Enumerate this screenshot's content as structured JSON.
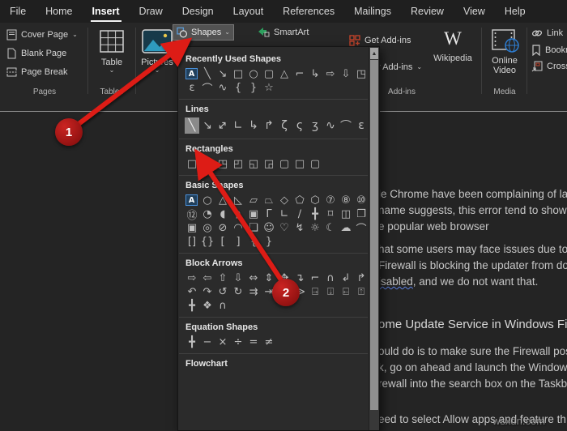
{
  "menu_tabs": [
    {
      "label": "File"
    },
    {
      "label": "Home"
    },
    {
      "label": "Insert",
      "active": true
    },
    {
      "label": "Draw"
    },
    {
      "label": "Design"
    },
    {
      "label": "Layout"
    },
    {
      "label": "References"
    },
    {
      "label": "Mailings"
    },
    {
      "label": "Review"
    },
    {
      "label": "View"
    },
    {
      "label": "Help"
    }
  ],
  "ribbon": {
    "pages_group": {
      "label": "Pages",
      "cover_page": "Cover Page",
      "blank_page": "Blank Page",
      "page_break": "Page Break"
    },
    "tables_group": {
      "label": "Tables",
      "table_button": "Table"
    },
    "pictures_button": "Pictures",
    "shapes_button": "Shapes",
    "smartart_button": "SmartArt",
    "addins_group": {
      "label": "Add-ins",
      "get_addins": "Get Add-ins",
      "my_addins": "My Add-ins",
      "wikipedia": "Wikipedia"
    },
    "media_group": {
      "label": "Media",
      "online": "Online",
      "video": "Video"
    },
    "links_group": {
      "link": "Link",
      "bookmark": "Bookmark",
      "cross_reference": "Cross-reference"
    }
  },
  "shapes_menu": {
    "sections": [
      {
        "title": "Recently Used Shapes",
        "rows": [
          [
            {
              "g": "A",
              "cls": "textbox"
            },
            "╲",
            "↘",
            "□",
            "○",
            "▢",
            "△",
            "⌐",
            "↳",
            "⇨",
            "⇩",
            "◳"
          ],
          [
            "ε",
            "⌒",
            "∿",
            "{",
            "}",
            "☆"
          ]
        ]
      },
      {
        "title": "Lines",
        "rows": [
          [
            {
              "g": "╲",
              "cls": "hl"
            },
            "↘",
            {
              "g": "↔",
              "rot": -45
            },
            "∟",
            "↳",
            "↱",
            "ζ",
            "ς",
            "ʒ",
            "∿",
            "⌒",
            "ε"
          ]
        ]
      },
      {
        "title": "Rectangles",
        "rows": [
          [
            "□",
            "▢",
            "◳",
            "◰",
            "◱",
            "◲",
            "▢",
            "□",
            "▢"
          ]
        ]
      },
      {
        "title": "Basic Shapes",
        "rows": [
          [
            {
              "g": "A",
              "cls": "textbox"
            },
            "○",
            "△",
            "◺",
            "▱",
            "⏢",
            "◇",
            "⬠",
            "⬡",
            "⑦",
            "⑧",
            "⑩"
          ],
          [
            "⑫",
            "◔",
            "◖",
            "◗",
            "▣",
            "Γ",
            "∟",
            "∕",
            "╋",
            "⌑",
            "◫",
            "❐"
          ],
          [
            "▣",
            "◎",
            "⊘",
            "◠",
            "❏",
            "☺",
            "♡",
            "↯",
            "☼",
            "☾",
            "☁",
            "⌒"
          ],
          [
            "[]",
            "{}",
            "[",
            "]",
            "{",
            "}"
          ]
        ]
      },
      {
        "title": "Block Arrows",
        "rows": [
          [
            "⇨",
            "⇦",
            "⇧",
            "⇩",
            "⇔",
            "⇕",
            "✥",
            "↴",
            "⌐",
            "∩",
            "↲",
            "↱"
          ],
          [
            "↶",
            "↷",
            "↺",
            "↻",
            "⇉",
            "⇥",
            "▷",
            "≫",
            "⍈",
            "⍗",
            "⍇",
            "⍐"
          ],
          [
            "╋",
            "❖",
            "∩"
          ]
        ]
      },
      {
        "title": "Equation Shapes",
        "rows": [
          [
            "╋",
            "−",
            "×",
            "÷",
            "=",
            "≠"
          ]
        ]
      },
      {
        "title": "Flowchart",
        "rows": []
      }
    ]
  },
  "document": {
    "lines": [
      {
        "segments": [
          {
            "t": "le Chrome have been complaining of la"
          }
        ]
      },
      {
        "segments": [
          {
            "t": "name suggests, this error tend to show"
          }
        ]
      },
      {
        "segments": [
          {
            "t": "e popular web browser"
          }
        ]
      },
      {
        "gap": "s",
        "segments": [
          {
            "t": "hat some users may face issues due to"
          }
        ]
      },
      {
        "segments": [
          {
            "t": "Firewall is blocking the updater from do"
          }
        ]
      },
      {
        "segments": [
          {
            "t": "isabled",
            "wavy": true
          },
          {
            "t": ", and we do not want that."
          }
        ]
      },
      {
        "gap": "xl",
        "heading": true,
        "segments": [
          {
            "t": "ome Update Service in Windows Firewa"
          }
        ]
      },
      {
        "gap": "m",
        "segments": [
          {
            "t": "ould do is to make sure the Firewall pos"
          }
        ]
      },
      {
        "segments": [
          {
            "t": "k, go on ahead and launch the Window"
          }
        ]
      },
      {
        "segments": [
          {
            "t": "rewall into the search box on the Taskb"
          }
        ]
      },
      {
        "gap": "l",
        "segments": [
          {
            "t": "eed to select Allow apps and feature th"
          }
        ]
      }
    ],
    "watermark": "wsxdn.com"
  },
  "annotations": {
    "step1": "1",
    "step2": "2"
  },
  "colors": {
    "annotation_red": "#dd1a12",
    "accent_blue": "#4a90d9",
    "selection_gray": "#8a8a8a"
  }
}
